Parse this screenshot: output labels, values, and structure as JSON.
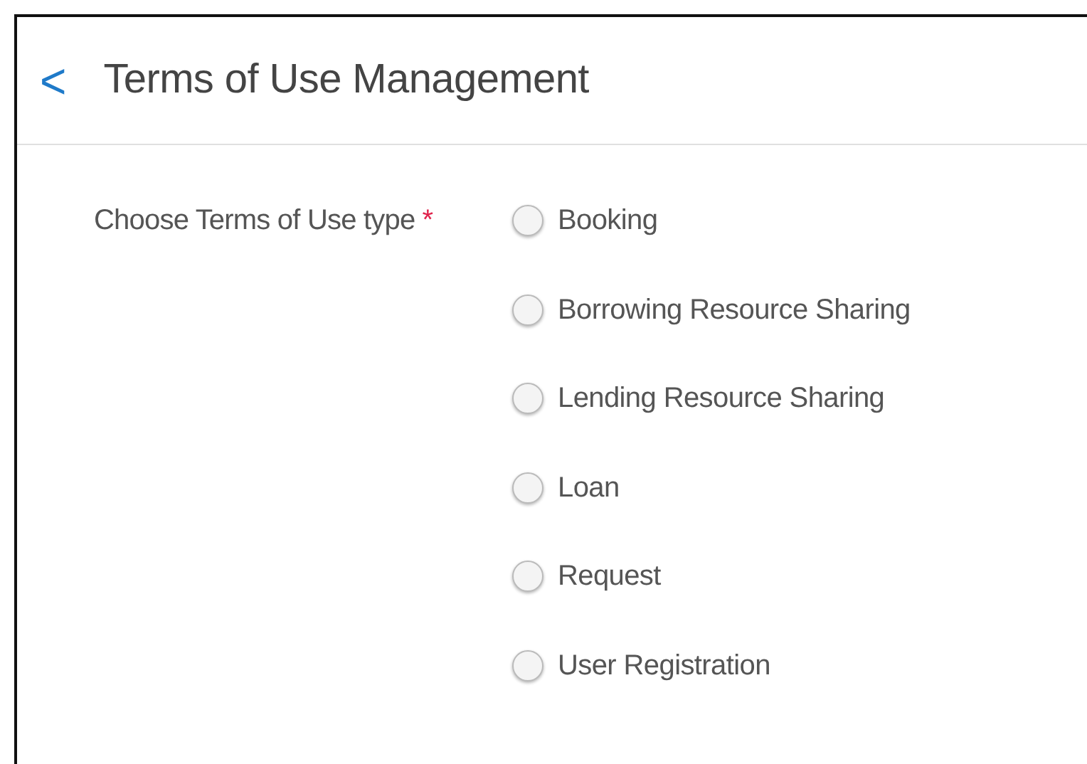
{
  "header": {
    "back": "<",
    "title": "Terms of Use Management"
  },
  "field": {
    "label": "Choose Terms of Use type",
    "required": true,
    "required_mark": "*"
  },
  "options": [
    {
      "label": "Booking",
      "selected": false
    },
    {
      "label": "Borrowing Resource Sharing",
      "selected": false
    },
    {
      "label": "Lending Resource Sharing",
      "selected": false
    },
    {
      "label": "Loan",
      "selected": false
    },
    {
      "label": "Request",
      "selected": false
    },
    {
      "label": "User Registration",
      "selected": false
    }
  ]
}
